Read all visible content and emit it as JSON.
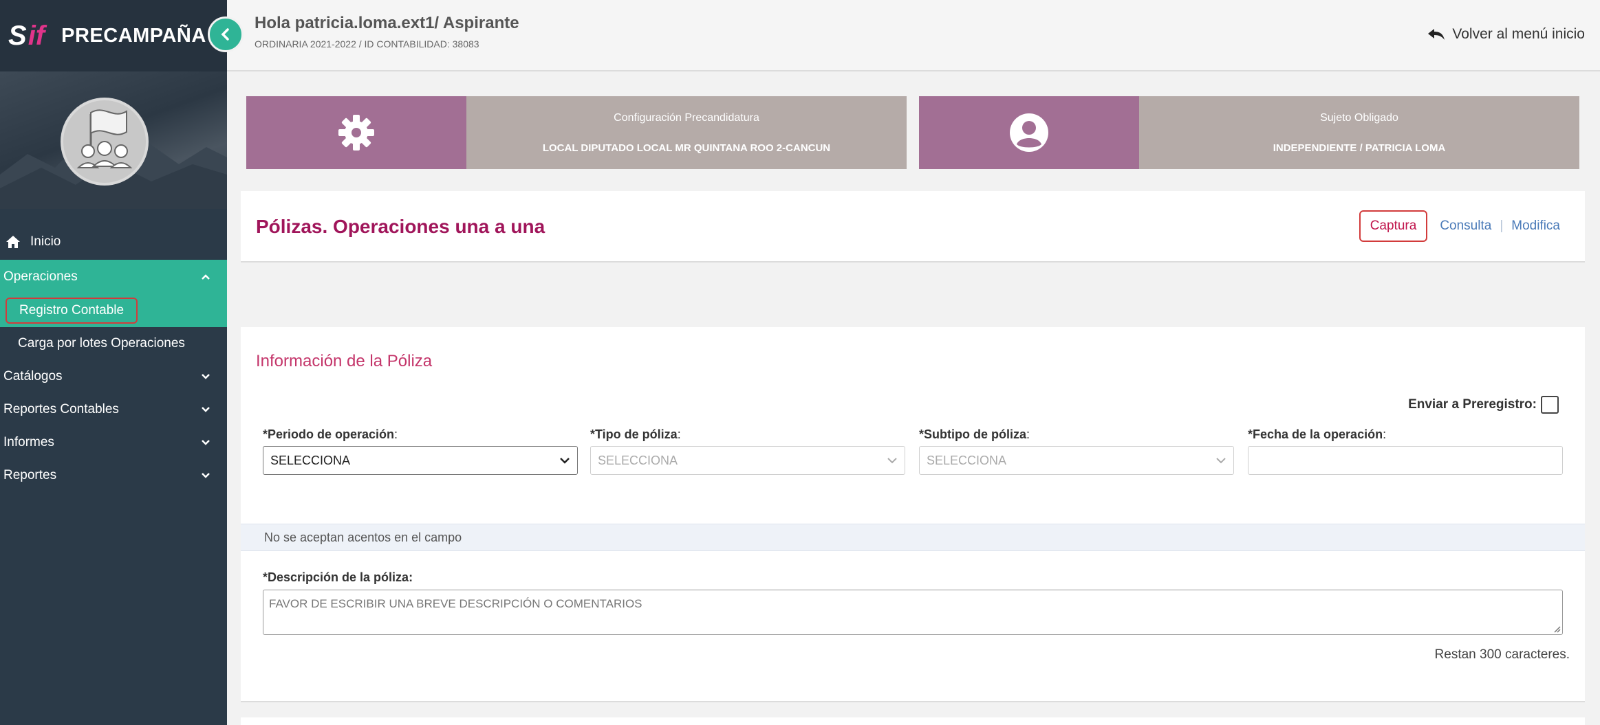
{
  "brand": {
    "logo_s": "S",
    "logo_if": "if",
    "title": "PRECAMPAÑA"
  },
  "sidebar": {
    "home": "Inicio",
    "operaciones": "Operaciones",
    "registro_contable": "Registro Contable",
    "carga_lotes": "Carga por lotes Operaciones",
    "catalogos": "Catálogos",
    "reportes_contables": "Reportes Contables",
    "informes": "Informes",
    "reportes": "Reportes"
  },
  "header": {
    "greeting": "Hola patricia.loma.ext1/ Aspirante",
    "subline": "ORDINARIA 2021-2022 / ID CONTABILIDAD: 38083",
    "back": "Volver al menú inicio"
  },
  "cards": {
    "config_label": "Configuración Precandidatura",
    "config_value": "LOCAL DIPUTADO LOCAL MR QUINTANA ROO 2-CANCUN",
    "sujeto_label": "Sujeto Obligado",
    "sujeto_value": "INDEPENDIENTE / PATRICIA LOMA"
  },
  "page": {
    "title": "Pólizas. Operaciones una a una",
    "tabs": {
      "captura": "Captura",
      "consulta": "Consulta",
      "sep": "|",
      "modifica": "Modifica"
    }
  },
  "form": {
    "section_title": "Información de la Póliza",
    "prereg_label": "Enviar a Preregistro:",
    "periodo_label": "*Periodo de operación",
    "periodo_value": "SELECCIONA",
    "tipo_label": "*Tipo de póliza",
    "tipo_value": "SELECCIONA",
    "subtipo_label": "*Subtipo de póliza",
    "subtipo_value": "SELECCIONA",
    "fecha_label": "*Fecha de la operación",
    "fecha_value": "",
    "colon": ":",
    "notice": "No se aceptan acentos en el campo",
    "desc_label": "*Descripción de la póliza:",
    "desc_placeholder": "FAVOR DE ESCRIBIR UNA BREVE DESCRIPCIÓN O COMENTARIOS",
    "remaining": "Restan 300 caracteres."
  },
  "colors": {
    "sidebar_bg": "#2b3a48",
    "accent_green": "#2fb496",
    "title_magenta": "#a0155a",
    "card_purple": "#a26f94",
    "card_grey": "#b5aba8"
  }
}
